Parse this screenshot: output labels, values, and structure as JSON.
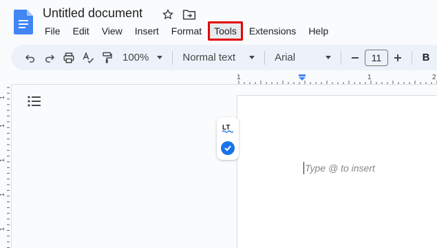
{
  "header": {
    "doc_title": "Untitled document",
    "icons": [
      "docs-logo-icon",
      "star-icon",
      "move-to-folder-icon"
    ]
  },
  "menu": {
    "items": [
      "File",
      "Edit",
      "View",
      "Insert",
      "Format",
      "Tools",
      "Extensions",
      "Help"
    ],
    "highlighted": "Tools",
    "highlight_color": "#e40000"
  },
  "toolbar": {
    "icons": [
      "undo-icon",
      "redo-icon",
      "print-icon",
      "spellcheck-icon",
      "paint-format-icon",
      "decrease-font-size-icon",
      "increase-font-size-icon"
    ],
    "zoom": "100%",
    "style": "Normal text",
    "font": "Arial",
    "font_size": "11",
    "bold": "B",
    "background": "#edf2fa"
  },
  "ruler": {
    "h_labels": [
      "1",
      "1",
      "2"
    ],
    "v_labels": [
      "1",
      "1",
      "1",
      "1",
      "1"
    ]
  },
  "document": {
    "placeholder": "Type @ to insert",
    "page_background": "#ffffff"
  },
  "side_widget": {
    "logo_text": "LT",
    "accent": "#1a73e8"
  }
}
